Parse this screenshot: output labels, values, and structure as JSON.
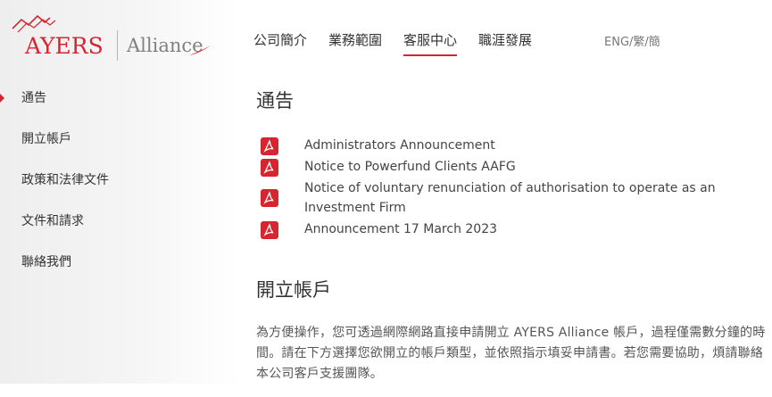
{
  "brand": {
    "name_left": "AYERS",
    "name_right": "Alliance",
    "color": "#d6252f"
  },
  "topnav": {
    "items": [
      {
        "label": "公司簡介",
        "active": false
      },
      {
        "label": "業務範圍",
        "active": false
      },
      {
        "label": "客服中心",
        "active": true
      },
      {
        "label": "職涯發展",
        "active": false
      }
    ],
    "language": "ENG/繁/簡"
  },
  "sidebar": {
    "items": [
      {
        "label": "通告",
        "active": true
      },
      {
        "label": "開立帳戶",
        "active": false
      },
      {
        "label": "政策和法律文件",
        "active": false
      },
      {
        "label": "文件和請求",
        "active": false
      },
      {
        "label": "聯絡我們",
        "active": false
      }
    ]
  },
  "main": {
    "notices_title": "通告",
    "notices": [
      {
        "title": "Administrators Announcement",
        "icon": "pdf-icon"
      },
      {
        "title": "Notice to Powerfund Clients AAFG",
        "icon": "pdf-icon"
      },
      {
        "title": "Notice of voluntary renunciation of authorisation to operate as an Investment Firm",
        "icon": "pdf-icon"
      },
      {
        "title": "Announcement 17 March 2023",
        "icon": "pdf-icon"
      }
    ],
    "account_title": "開立帳戶",
    "account_text": "為方便操作，您可透過網際網路直接申請開立 AYERS Alliance 帳戶，過程僅需數分鐘的時間。請在下方選擇您欲開立的帳戶類型，並依照指示填妥申請書。若您需要協助，煩請聯絡本公司客戶支援團隊。"
  }
}
